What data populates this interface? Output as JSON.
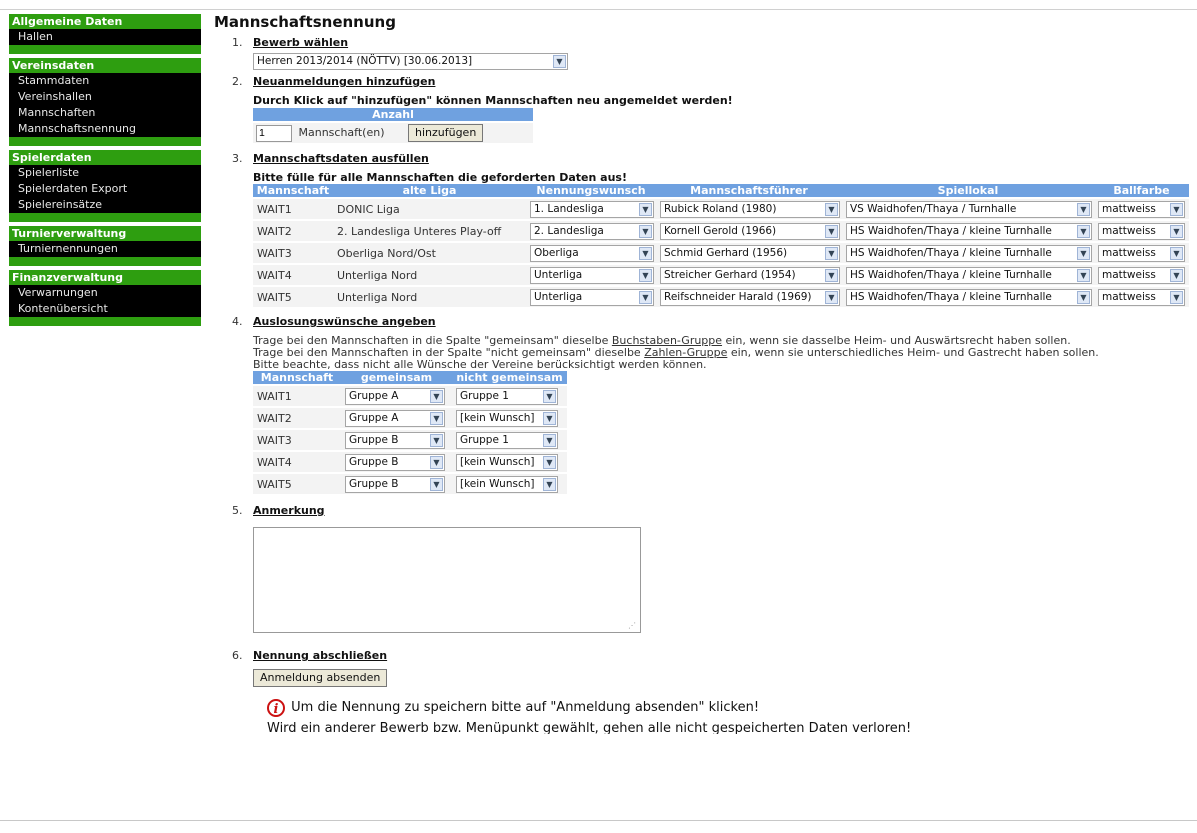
{
  "sidebar": {
    "sections": [
      {
        "title": "Allgemeine Daten",
        "items": [
          "Hallen"
        ]
      },
      {
        "title": "Vereinsdaten",
        "items": [
          "Stammdaten",
          "Vereinshallen",
          "Mannschaften",
          "Mannschaftsnennung"
        ]
      },
      {
        "title": "Spielerdaten",
        "items": [
          "Spielerliste",
          "Spielerdaten Export",
          "Spielereinsätze"
        ]
      },
      {
        "title": "Turnierverwaltung",
        "items": [
          "Turniernennungen"
        ]
      },
      {
        "title": "Finanzverwaltung",
        "items": [
          "Verwarnungen",
          "Kontenübersicht"
        ]
      }
    ]
  },
  "page": {
    "title": "Mannschaftsnennung"
  },
  "steps": [
    {
      "num": "1.",
      "title": "Bewerb wählen"
    },
    {
      "num": "2.",
      "title": "Neuanmeldungen hinzufügen"
    },
    {
      "num": "3.",
      "title": "Mannschaftsdaten ausfüllen"
    },
    {
      "num": "4.",
      "title": "Auslosungswünsche angeben"
    },
    {
      "num": "5.",
      "title": "Anmerkung"
    },
    {
      "num": "6.",
      "title": "Nennung abschließen"
    }
  ],
  "bewerb": {
    "selected": "Herren 2013/2014 (NÖTTV) [30.06.2013]"
  },
  "add": {
    "intro": "Durch Klick auf \"hinzufügen\" können Mannschaften neu angemeldet werden!",
    "header": "Anzahl",
    "count_value": "1",
    "unit_label": "Mannschaft(en)",
    "button": "hinzufügen"
  },
  "teams": {
    "intro": "Bitte fülle für alle Mannschaften die geforderten Daten aus!",
    "headers": [
      "Mannschaft",
      "alte Liga",
      "Nennungswunsch",
      "Mannschaftsführer",
      "Spiellokal",
      "Ballfarbe"
    ],
    "rows": [
      {
        "team": "WAIT1",
        "liga": "DONIC Liga",
        "wunsch": "1. Landesliga",
        "fuehrer": "Rubick Roland (1980)",
        "lokal": "VS Waidhofen/Thaya / Turnhalle",
        "ball": "mattweiss"
      },
      {
        "team": "WAIT2",
        "liga": "2. Landesliga Unteres Play-off",
        "wunsch": "2. Landesliga",
        "fuehrer": "Kornell Gerold (1966)",
        "lokal": "HS Waidhofen/Thaya / kleine Turnhalle",
        "ball": "mattweiss"
      },
      {
        "team": "WAIT3",
        "liga": "Oberliga Nord/Ost",
        "wunsch": "Oberliga",
        "fuehrer": "Schmid Gerhard (1956)",
        "lokal": "HS Waidhofen/Thaya / kleine Turnhalle",
        "ball": "mattweiss"
      },
      {
        "team": "WAIT4",
        "liga": "Unterliga Nord",
        "wunsch": "Unterliga",
        "fuehrer": "Streicher Gerhard (1954)",
        "lokal": "HS Waidhofen/Thaya / kleine Turnhalle",
        "ball": "mattweiss"
      },
      {
        "team": "WAIT5",
        "liga": "Unterliga Nord",
        "wunsch": "Unterliga",
        "fuehrer": "Reifschneider Harald (1969)",
        "lokal": "HS Waidhofen/Thaya / kleine Turnhalle",
        "ball": "mattweiss"
      }
    ]
  },
  "draw": {
    "line1_pre": "Trage bei den Mannschaften in die Spalte \"gemeinsam\" dieselbe ",
    "line1_link": "Buchstaben-Gruppe",
    "line1_post": " ein, wenn sie dasselbe Heim- und Auswärtsrecht haben sollen.",
    "line2_pre": "Trage bei den Mannschaften in der Spalte \"nicht gemeinsam\" dieselbe ",
    "line2_link": "Zahlen-Gruppe",
    "line2_post": " ein, wenn sie unterschiedliches Heim- und Gastrecht haben sollen.",
    "line3": "Bitte beachte, dass nicht alle Wünsche der Vereine berücksichtigt werden können.",
    "headers": [
      "Mannschaft",
      "gemeinsam",
      "nicht gemeinsam"
    ],
    "rows": [
      {
        "team": "WAIT1",
        "gemeinsam": "Gruppe A",
        "nicht": "Gruppe 1"
      },
      {
        "team": "WAIT2",
        "gemeinsam": "Gruppe A",
        "nicht": "[kein Wunsch]"
      },
      {
        "team": "WAIT3",
        "gemeinsam": "Gruppe B",
        "nicht": "Gruppe 1"
      },
      {
        "team": "WAIT4",
        "gemeinsam": "Gruppe B",
        "nicht": "[kein Wunsch]"
      },
      {
        "team": "WAIT5",
        "gemeinsam": "Gruppe B",
        "nicht": "[kein Wunsch]"
      }
    ]
  },
  "note": {
    "value": ""
  },
  "submit": {
    "button": "Anmeldung absenden",
    "info": "Um die Nennung zu speichern bitte auf \"Anmeldung absenden\" klicken!",
    "warning": "Wird ein anderer Bewerb bzw. Menüpunkt gewählt, gehen alle nicht gespeicherten Daten verloren!"
  },
  "colors": {
    "sidebar_green": "#2e9e10",
    "table_header_blue": "#6fa1e0",
    "info_red": "#cc1111"
  },
  "icons": {
    "select_arrow": "chevron-down-icon",
    "info": "info-icon",
    "resize": "resize-grip-icon"
  }
}
